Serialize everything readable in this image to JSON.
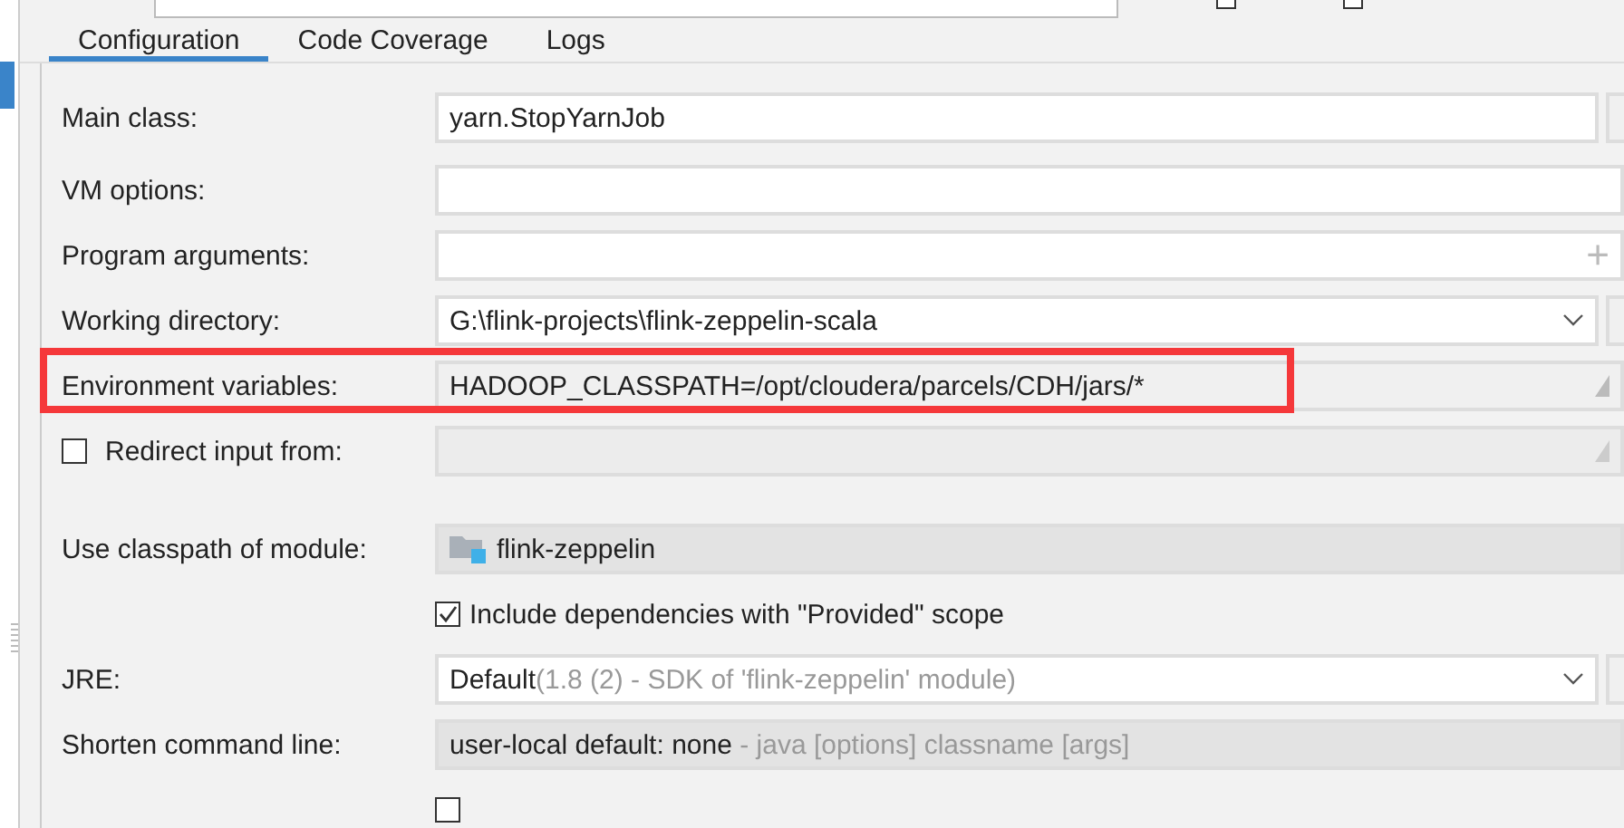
{
  "top_bar": {
    "checkboxes": [
      {
        "checked": false
      },
      {
        "checked": false
      }
    ]
  },
  "tabs": [
    {
      "label": "Configuration",
      "selected": true
    },
    {
      "label": "Code Coverage",
      "selected": false
    },
    {
      "label": "Logs",
      "selected": false
    }
  ],
  "rows": [
    {
      "kind": "field",
      "label": "Main class:",
      "value": "yarn.StopYarnJob"
    },
    {
      "kind": "field",
      "label": "VM options:"
    },
    {
      "kind": "args-field",
      "label": "Program arguments:",
      "icon": "+"
    },
    {
      "kind": "combo",
      "label": "Working directory:",
      "value": "G:\\flink-projects\\flink-zeppelin-scala"
    },
    {
      "kind": "env-field",
      "label": "Environment variables:",
      "value": "HADOOP_CLASSPATH=/opt/cloudera/parcels/CDH/jars/*",
      "highlighted": true
    },
    {
      "kind": "checkbox-field",
      "label": "Redirect input from:",
      "checked": false
    },
    {
      "kind": "module-field",
      "label": "Use classpath of module:",
      "value": "flink-zeppelin"
    },
    {
      "kind": "checkbox",
      "label": "Include dependencies with \"Provided\" scope",
      "checked": true
    },
    {
      "kind": "combo",
      "label": "JRE:",
      "value": "Default",
      "hint": "(1.8 (2) - SDK of 'flink-zeppelin' module)"
    },
    {
      "kind": "readonly-field",
      "label": "Shorten command line:",
      "value": "user-local default: none",
      "hint": "- java [options] classname [args]"
    },
    {
      "kind": "checkbox",
      "checked": false
    }
  ]
}
